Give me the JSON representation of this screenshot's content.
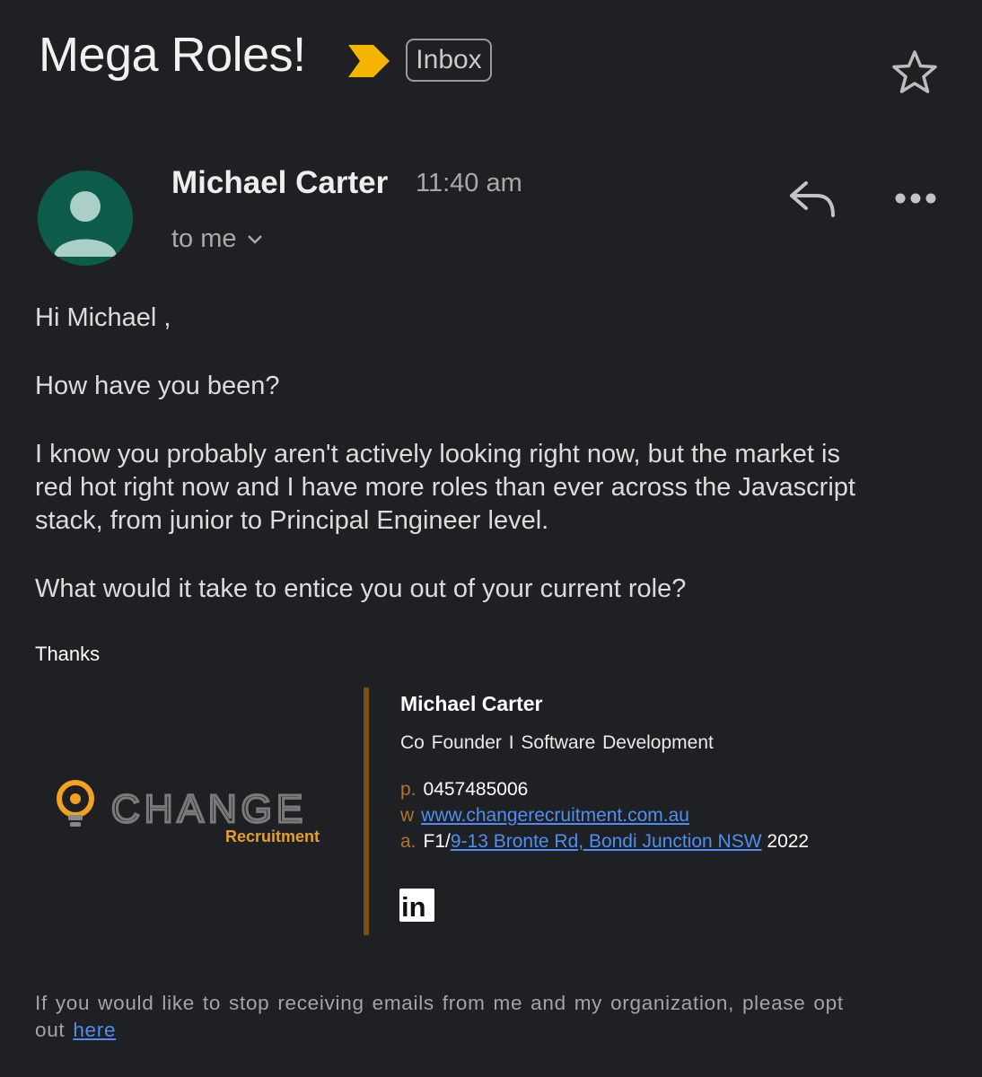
{
  "email": {
    "subject": "Mega Roles!",
    "label": "Inbox",
    "sender_name": "Michael Carter",
    "time": "11:40 am",
    "recipient": "to me",
    "colors": {
      "background": "#1f2023",
      "importance_marker": "#f5b400",
      "avatar": "#0d5c4a",
      "link": "#4f8ef0",
      "signature_accent": "#7a4f12"
    },
    "icons": {
      "importance": "importance-marker-icon",
      "star": "star-icon",
      "reply": "reply-icon",
      "more": "more-options-icon",
      "expand": "chevron-down-icon"
    }
  },
  "body": {
    "greeting": "Hi Michael ,",
    "question": "How have you been?",
    "pitch": "I know you probably aren't actively looking right now, but the market is red hot right now and I have more roles than ever across the Javascript stack, from junior to Principal Engineer level.",
    "ask": "What would it take to entice you out of your current role?",
    "signoff": "Thanks"
  },
  "signature": {
    "name": "Michael Carter",
    "title": "Co Founder I Software Development",
    "phone_key": "p.",
    "phone": "0457485006",
    "web_key": "w",
    "website": "www.changerecruitment.com.au",
    "address_key": "a.",
    "address_prefix": "F1/",
    "address_link": "9-13 Bronte Rd, Bondi Junction NSW",
    "address_postcode": "2022",
    "logo_word": "CHANGE",
    "logo_sub": "Recruitment",
    "social": "in"
  },
  "footer": {
    "text": "If you would like to stop receiving emails from me and my organization, please opt out",
    "link": "here"
  }
}
